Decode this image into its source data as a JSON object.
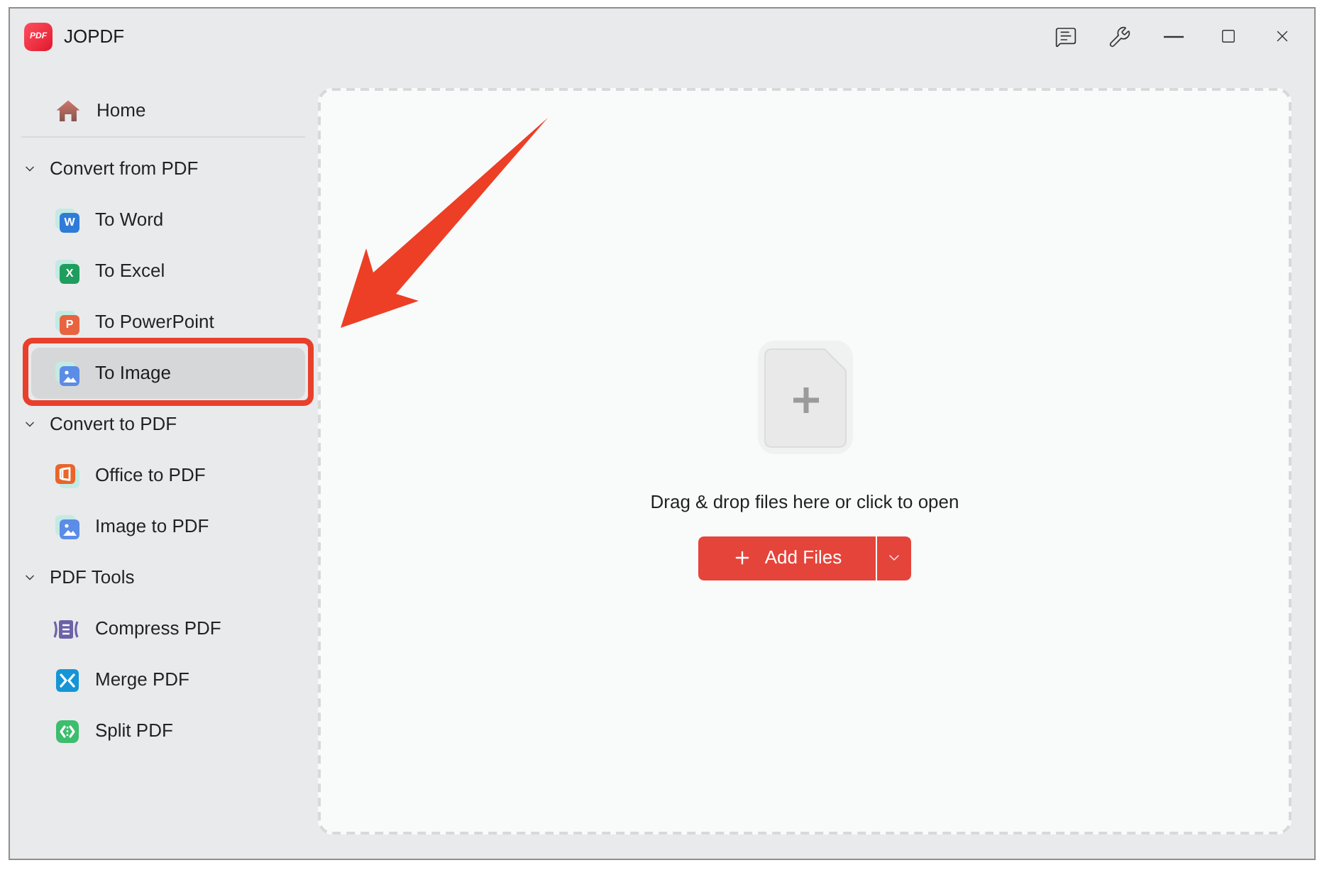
{
  "window": {
    "logo_text": "PDF",
    "title": "JOPDF"
  },
  "sidebar": {
    "home": {
      "label": "Home",
      "selected": false,
      "highlighted": false
    },
    "sections": [
      {
        "title": "Convert from PDF",
        "expanded": true,
        "items": [
          {
            "label": "To Word",
            "kind": "word",
            "icon_text": "W",
            "selected": false,
            "highlighted": false
          },
          {
            "label": "To Excel",
            "kind": "excel",
            "icon_text": "X",
            "selected": false,
            "highlighted": false
          },
          {
            "label": "To PowerPoint",
            "kind": "powerpoint",
            "icon_text": "P",
            "selected": false,
            "highlighted": false
          },
          {
            "label": "To Image",
            "kind": "image",
            "selected": true,
            "highlighted": true
          }
        ]
      },
      {
        "title": "Convert to PDF",
        "expanded": true,
        "items": [
          {
            "label": "Office to PDF",
            "kind": "office",
            "selected": false,
            "highlighted": false
          },
          {
            "label": "Image to PDF",
            "kind": "image",
            "selected": false,
            "highlighted": false
          }
        ]
      },
      {
        "title": "PDF Tools",
        "expanded": true,
        "items": [
          {
            "label": "Compress PDF",
            "kind": "compress",
            "selected": false,
            "highlighted": false
          },
          {
            "label": "Merge PDF",
            "kind": "merge",
            "selected": false,
            "highlighted": false
          },
          {
            "label": "Split PDF",
            "kind": "split",
            "selected": false,
            "highlighted": false
          }
        ]
      }
    ]
  },
  "drop_zone": {
    "hint": "Drag & drop files here or click to open",
    "button": {
      "label": "Add Files"
    }
  }
}
